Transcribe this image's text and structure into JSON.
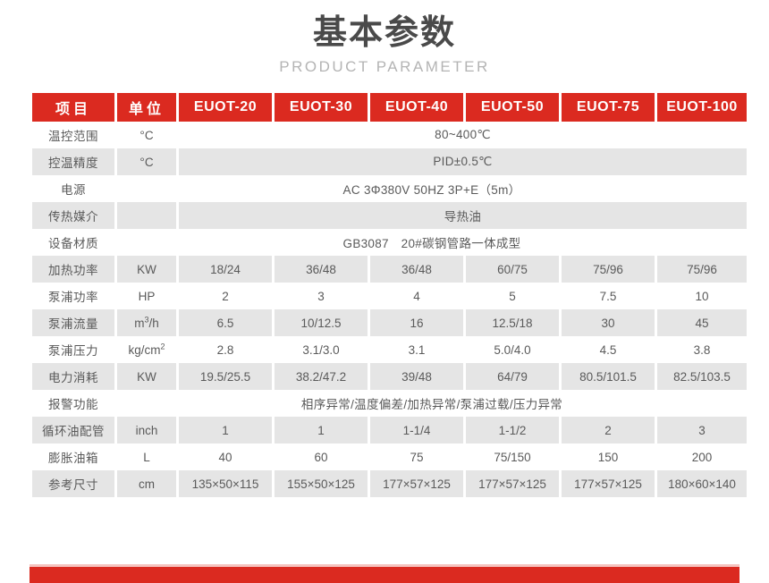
{
  "header": {
    "title_cn": "基本参数",
    "title_en": "PRODUCT PARAMETER"
  },
  "colors": {
    "accent_red": "#DB2A20",
    "stripe_gray": "#E5E5E5",
    "title_gray": "#4a4a4a",
    "subtitle_gray": "#b4b4b4",
    "text_gray": "#555555"
  },
  "table": {
    "columns": [
      {
        "key": "item",
        "label": "项目"
      },
      {
        "key": "unit",
        "label": "单位"
      },
      {
        "key": "m20",
        "label": "EUOT-20"
      },
      {
        "key": "m30",
        "label": "EUOT-30"
      },
      {
        "key": "m40",
        "label": "EUOT-40"
      },
      {
        "key": "m50",
        "label": "EUOT-50"
      },
      {
        "key": "m75",
        "label": "EUOT-75"
      },
      {
        "key": "m100",
        "label": "EUOT-100"
      }
    ],
    "rows": [
      {
        "label": "温控范围",
        "unit": "°C",
        "merged": true,
        "merged_value": "80~400℃",
        "stripe": false
      },
      {
        "label": "控温精度",
        "unit": "°C",
        "merged": true,
        "merged_value": "PID±0.5℃",
        "stripe": true
      },
      {
        "label": "电源",
        "unit": "",
        "merged": true,
        "merged_unit": true,
        "merged_value": "AC 3Φ380V 50HZ 3P+E（5m）",
        "stripe": false
      },
      {
        "label": "传热媒介",
        "unit": "",
        "merged": true,
        "merged_value": "导热油",
        "stripe": true
      },
      {
        "label": "设备材质",
        "unit": "",
        "merged": true,
        "merged_unit": true,
        "merged_value": "GB3087　20#碳钢管路一体成型",
        "stripe": false
      },
      {
        "label": "加热功率",
        "unit": "KW",
        "merged": false,
        "values": [
          "18/24",
          "36/48",
          "36/48",
          "60/75",
          "75/96",
          "75/96"
        ],
        "stripe": true
      },
      {
        "label": "泵浦功率",
        "unit": "HP",
        "merged": false,
        "values": [
          "2",
          "3",
          "4",
          "5",
          "7.5",
          "10"
        ],
        "stripe": false
      },
      {
        "label": "泵浦流量",
        "unit": "m3/h",
        "unit_html": "m<sup>3</sup>/h",
        "merged": false,
        "values": [
          "6.5",
          "10/12.5",
          "16",
          "12.5/18",
          "30",
          "45"
        ],
        "stripe": true
      },
      {
        "label": "泵浦压力",
        "unit": "kg/cm2",
        "unit_html": "kg/cm<sup>2</sup>",
        "merged": false,
        "values": [
          "2.8",
          "3.1/3.0",
          "3.1",
          "5.0/4.0",
          "4.5",
          "3.8"
        ],
        "stripe": false
      },
      {
        "label": "电力消耗",
        "unit": "KW",
        "merged": false,
        "values": [
          "19.5/25.5",
          "38.2/47.2",
          "39/48",
          "64/79",
          "80.5/101.5",
          "82.5/103.5"
        ],
        "stripe": true
      },
      {
        "label": "报警功能",
        "unit": "",
        "merged": true,
        "merged_unit": true,
        "merged_value": "相序异常/温度偏差/加热异常/泵浦过载/压力异常",
        "stripe": false
      },
      {
        "label": "循环油配管",
        "unit": "inch",
        "merged": false,
        "values": [
          "1",
          "1",
          "1-1/4",
          "1-1/2",
          "2",
          "3"
        ],
        "stripe": true
      },
      {
        "label": "膨胀油箱",
        "unit": "L",
        "merged": false,
        "values": [
          "40",
          "60",
          "75",
          "75/150",
          "150",
          "200"
        ],
        "stripe": false
      },
      {
        "label": "参考尺寸",
        "unit": "cm",
        "merged": false,
        "values": [
          "135×50×115",
          "155×50×125",
          "177×57×125",
          "177×57×125",
          "177×57×125",
          "180×60×140"
        ],
        "stripe": true
      }
    ]
  }
}
